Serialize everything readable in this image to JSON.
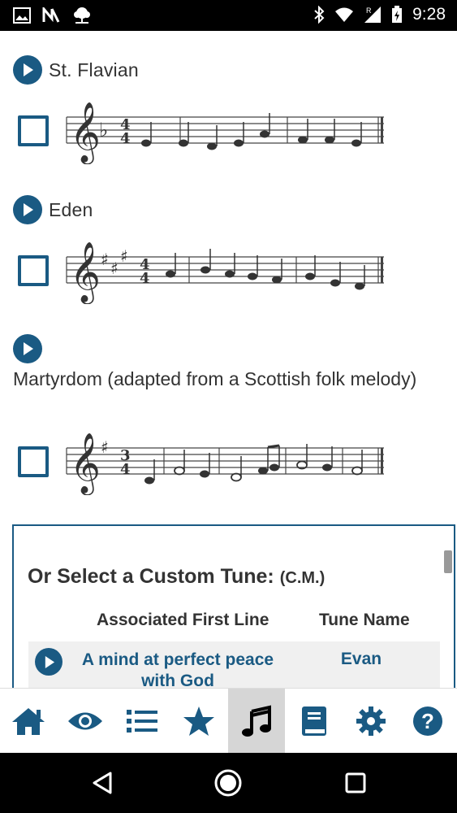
{
  "status_bar": {
    "time": "9:28"
  },
  "tunes": [
    {
      "title": "St. Flavian"
    },
    {
      "title": "Eden"
    },
    {
      "title": "Martyrdom (adapted from a Scottish folk melody)"
    }
  ],
  "custom": {
    "title": "Or Select a Custom Tune:",
    "meter": "(C.M.)",
    "col_first_line": "Associated First Line",
    "col_tune_name": "Tune Name",
    "rows": [
      {
        "first_line": "A mind at perfect peace with God",
        "tune_name": "Evan"
      }
    ]
  },
  "tabs": [
    "home-icon",
    "eye-icon",
    "list-icon",
    "star-icon",
    "music-icon",
    "book-icon",
    "gear-icon",
    "help-icon"
  ],
  "colors": {
    "accent": "#1a5a83",
    "active_tab": "#d6d6d6"
  }
}
